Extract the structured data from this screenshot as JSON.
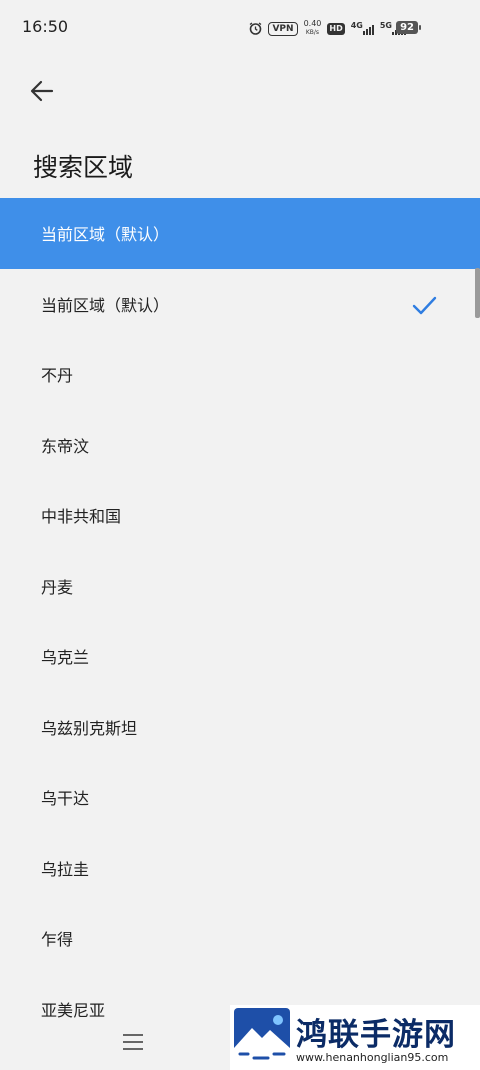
{
  "status": {
    "time": "16:50",
    "vpn": "VPN",
    "speed_value": "0.40",
    "speed_unit": "KB/s",
    "hd": "HD",
    "net1": "4G",
    "net2": "5G",
    "battery": "92"
  },
  "header": {
    "title": "搜索区域"
  },
  "list": {
    "highlighted": "当前区域（默认）",
    "selected": "当前区域（默认）",
    "items": [
      "不丹",
      "东帝汶",
      "中非共和国",
      "丹麦",
      "乌克兰",
      "乌兹别克斯坦",
      "乌干达",
      "乌拉圭",
      "乍得",
      "亚美尼亚"
    ]
  },
  "watermark": {
    "title": "鸿联手游网",
    "url": "www.henanhonglian95.com"
  },
  "colors": {
    "accent": "#3f8fe9",
    "check": "#2f7de1",
    "background": "#f2f2f2"
  }
}
